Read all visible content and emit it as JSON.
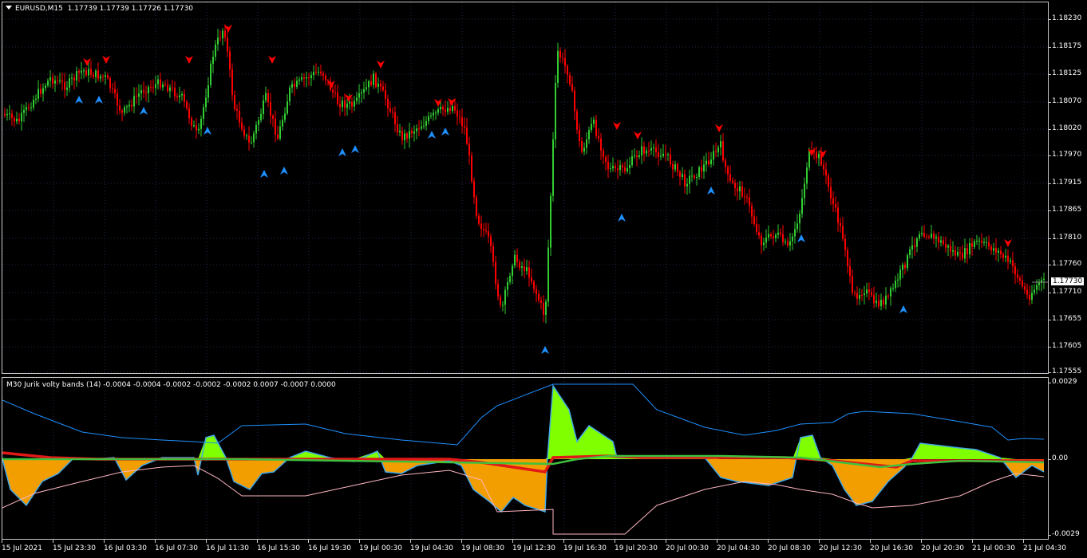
{
  "chart": {
    "symbol_label": "EURUSD,M15",
    "quotes": "1.17739 1.17739 1.17726 1.17730",
    "current_price": "1.17730",
    "price_ticks": [
      "1.18230",
      "1.18175",
      "1.18125",
      "1.18070",
      "1.18020",
      "1.17970",
      "1.17915",
      "1.17865",
      "1.17810",
      "1.17760",
      "1.17710",
      "1.17655",
      "1.17605",
      "1.17555"
    ],
    "time_ticks": [
      "15 Jul 2021",
      "15 Jul 23:30",
      "16 Jul 03:30",
      "16 Jul 07:30",
      "16 Jul 11:30",
      "16 Jul 15:30",
      "16 Jul 19:30",
      "19 Jul 00:30",
      "19 Jul 04:30",
      "19 Jul 08:30",
      "19 Jul 12:30",
      "19 Jul 16:30",
      "19 Jul 20:30",
      "20 Jul 00:30",
      "20 Jul 04:30",
      "20 Jul 08:30",
      "20 Jul 12:30",
      "20 Jul 16:30",
      "20 Jul 20:30",
      "21 Jul 00:30",
      "21 Jul 04:30"
    ]
  },
  "indicator": {
    "title": "M30 Jurik volty bands (14) -0.0004 -0.0004 -0.0002 -0.0002 -0.0002 0.0007 -0.0007 0.0000",
    "ticks": [
      "0.0029",
      "0.00",
      "-0.0029"
    ]
  },
  "colors": {
    "background": "#000000",
    "bull": "#32cd32",
    "bear": "#ff0000",
    "arrow_up": "#1e90ff",
    "arrow_down": "#ff0000",
    "histo_pos": "#7fff00",
    "histo_neg": "#ffa500",
    "upper_band": "#1e90ff",
    "lower_band": "#ffb6c1",
    "grid": "#1c2a4a"
  }
}
